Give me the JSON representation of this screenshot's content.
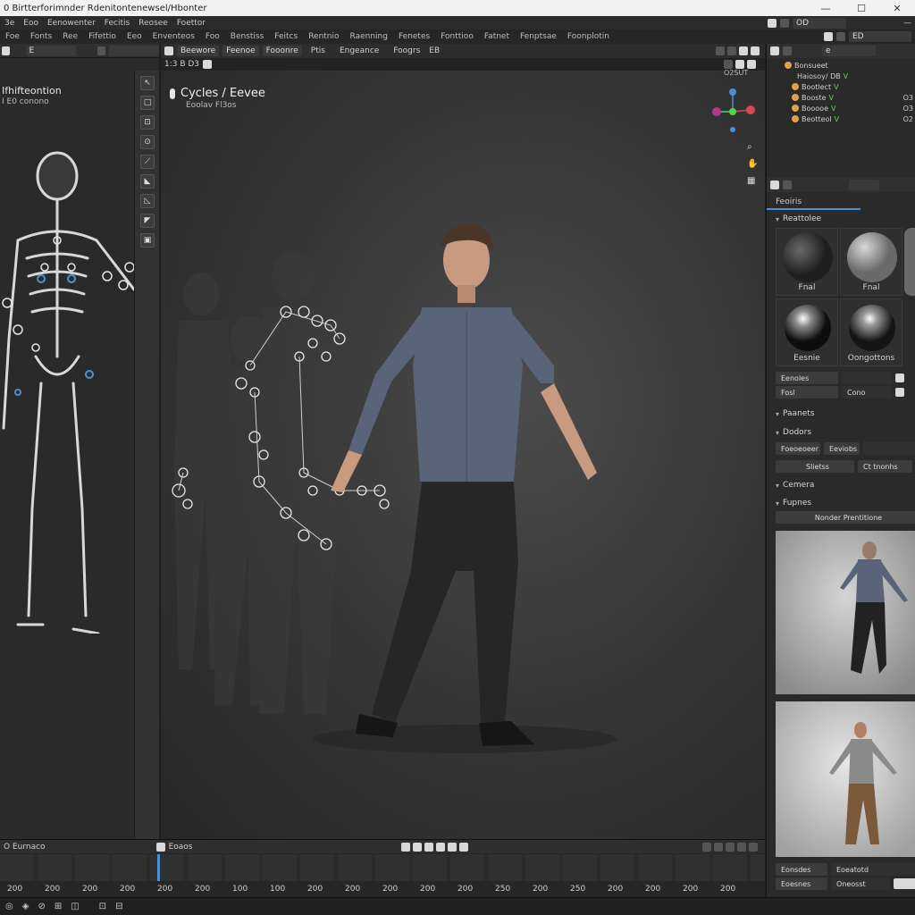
{
  "window": {
    "title": "0 Birtterforimnder Rdenitontenewsel/Hbonter",
    "controls": [
      "—",
      "☐",
      "✕"
    ]
  },
  "menubar": {
    "items": [
      "3e",
      "Eoo",
      "Eenowenter",
      "Fecitis",
      "Reosee",
      "Foettor"
    ],
    "right_field": "OD"
  },
  "workspaces": {
    "items": [
      "Foe",
      "Fonts",
      "Ree",
      "Fifettio",
      "Eeo",
      "Enventeos",
      "Foo",
      "Benstiss",
      "Feitcs",
      "Rentnio",
      "Raenning",
      "Fenetes",
      "Fonttioo",
      "Fatnet",
      "Fenptsae",
      "Foonplotin"
    ],
    "right_field": "ED"
  },
  "left_panel": {
    "header_field": "E",
    "title": "Ifhifteontion",
    "subtitle": "I E0 conono",
    "tool_icons": [
      "↖",
      "□",
      "⊡",
      "⊙",
      "⟋",
      "◣",
      "◺",
      "◤",
      "▣"
    ]
  },
  "viewport": {
    "header_tabs": [
      "Beewore",
      "Feenoe",
      "Fooonre",
      "Ptis",
      "Engeance",
      "Foogrs",
      "EB"
    ],
    "sub_header": "1:3 B D3",
    "engine_label": "Cycles / Eevee",
    "engine_sub": "Eoolav Fl3os",
    "gizmo_label": "O2SUT"
  },
  "outliner": {
    "search": "e",
    "rows": [
      {
        "label": "Bonsueet",
        "suffix": "",
        "num": ""
      },
      {
        "label": "Haiosoy/ DB",
        "suffix": "V",
        "num": ""
      },
      {
        "label": "Bootlect",
        "suffix": "V",
        "num": ""
      },
      {
        "label": "Booste",
        "suffix": "V",
        "num": "O3"
      },
      {
        "label": "Booooe",
        "suffix": "V",
        "num": "O3"
      },
      {
        "label": "Beotteol",
        "suffix": "V",
        "num": "O2"
      }
    ]
  },
  "properties": {
    "tab": "Feoiris",
    "section_materials": "Reattolee",
    "materials": [
      {
        "label": "Fnal",
        "kind": "matte"
      },
      {
        "label": "Fnal",
        "kind": "grey"
      },
      {
        "label": "Eesnie",
        "kind": "chrome"
      },
      {
        "label": "Oongottons",
        "kind": "chrome2"
      }
    ],
    "row1_label": "Eenoles",
    "row2_label": "Fosl",
    "row2_value": "Cono",
    "section_paanets": "Paanets",
    "section_dodors": "Dodors",
    "btn_a": "Foeoeoeer",
    "btn_b": "Eeviobs",
    "btn_c": "Slietss",
    "btn_d": "Ct tnonhs",
    "section_camera": "Cemera",
    "section_fupnes": "Fupnes",
    "render_preview": "Nonder Prentitione",
    "bottom_row1_a": "Eonsdes",
    "bottom_row1_b": "Eoeatotd",
    "bottom_row2_a": "Eoesnes",
    "bottom_row2_b": "Oneosst"
  },
  "timeline": {
    "header_left": "O Eurnaco",
    "header_mid": "Eoaos",
    "ticks": [
      "200",
      "200",
      "200",
      "200",
      "200",
      "200",
      "100",
      "100",
      "200",
      "200",
      "200",
      "200",
      "200",
      "250",
      "200",
      "250",
      "200",
      "200",
      "200",
      "200"
    ]
  },
  "statusbar": {
    "icons": [
      "◎",
      "◈",
      "⊘",
      "⊞",
      "◫",
      "⊡",
      "⊟"
    ]
  },
  "colors": {
    "accent_blue": "#4a90d9",
    "shirt": "#5a6478",
    "outliner_check": "#5fd35f"
  }
}
